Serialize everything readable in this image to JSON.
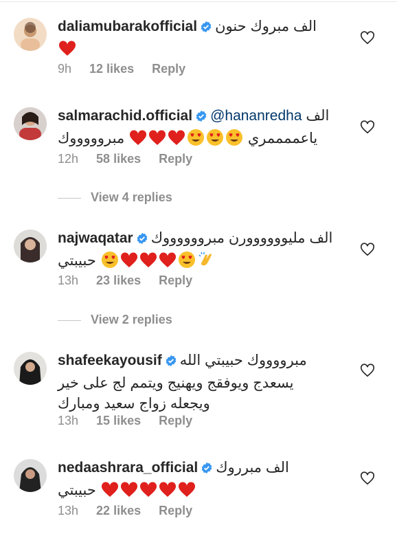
{
  "comments": [
    {
      "username": "daliamubarakofficial",
      "text_line1": "الف مبروك حنون",
      "text_line2": "",
      "time": "9h",
      "likes": "12 likes",
      "reply": "Reply",
      "avatar_color": "#e8c9a8"
    },
    {
      "username": "salmarachid.official",
      "mention": "@hananredha",
      "text_line1": "الف",
      "text_line2": "مبروووووك",
      "text_line2_suffix": "ياعممممري",
      "time": "12h",
      "likes": "58 likes",
      "reply": "Reply",
      "avatar_color": "#c23a3a"
    },
    {
      "username": "najwaqatar",
      "text_line1": "الف مليوووووورن مبرووووووك",
      "text_line2": "حبيبتي",
      "time": "13h",
      "likes": "23 likes",
      "reply": "Reply",
      "avatar_color": "#6b5a58"
    },
    {
      "username": "shafeekayousif",
      "text_line1": "مبرووووك حبيبتي الله",
      "text_line2": "يسعدج ويوفقج ويهنيج ويتمم لج على خير",
      "text_line3": "ويجعله زواج سعيد ومبارك",
      "time": "13h",
      "likes": "15 likes",
      "reply": "Reply",
      "avatar_color": "#2b2b2b"
    },
    {
      "username": "nedaashrara_official",
      "text_line1": "الف مبرروك",
      "text_line2": "حبيبتي",
      "time": "13h",
      "likes": "22 likes",
      "reply": "Reply",
      "avatar_color": "#3a3a3a"
    }
  ],
  "view_replies": [
    {
      "label": "View 4 replies"
    },
    {
      "label": "View 2 replies"
    }
  ],
  "colors": {
    "verified_badge": "#3897f0",
    "heart": "#ed4956",
    "meta_gray": "#8e8e8e",
    "mention": "#00376b"
  }
}
